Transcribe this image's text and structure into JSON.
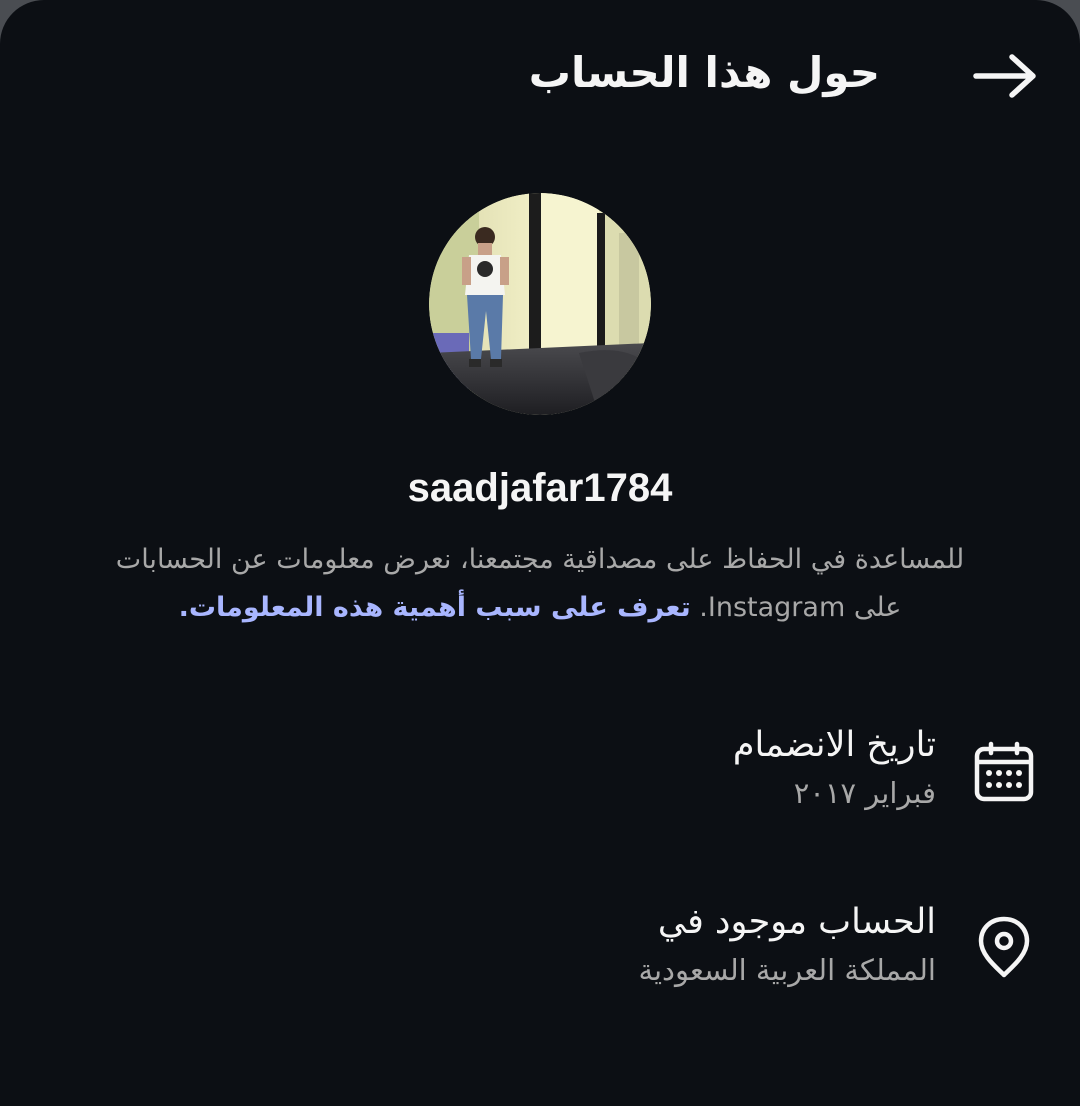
{
  "header": {
    "title": "حول هذا الحساب",
    "back_icon": "arrow-right-icon"
  },
  "profile": {
    "avatar_icon": "profile-photo",
    "username": "saadjafar1784"
  },
  "disclaimer": {
    "text": "للمساعدة في الحفاظ على مصداقية مجتمعنا، نعرض معلومات عن الحسابات على Instagram. ",
    "link_label": "تعرف على سبب أهمية هذه المعلومات."
  },
  "info": {
    "joined": {
      "icon": "calendar-icon",
      "label": "تاريخ الانضمام",
      "value": "فبراير ٢٠١٧"
    },
    "location": {
      "icon": "location-pin-icon",
      "label": "الحساب موجود في",
      "value": "المملكة العربية السعودية"
    }
  },
  "colors": {
    "background": "#0c0f14",
    "text_primary": "#f5f5f5",
    "text_secondary": "#a8a8a8",
    "link": "#a9b6ff"
  }
}
